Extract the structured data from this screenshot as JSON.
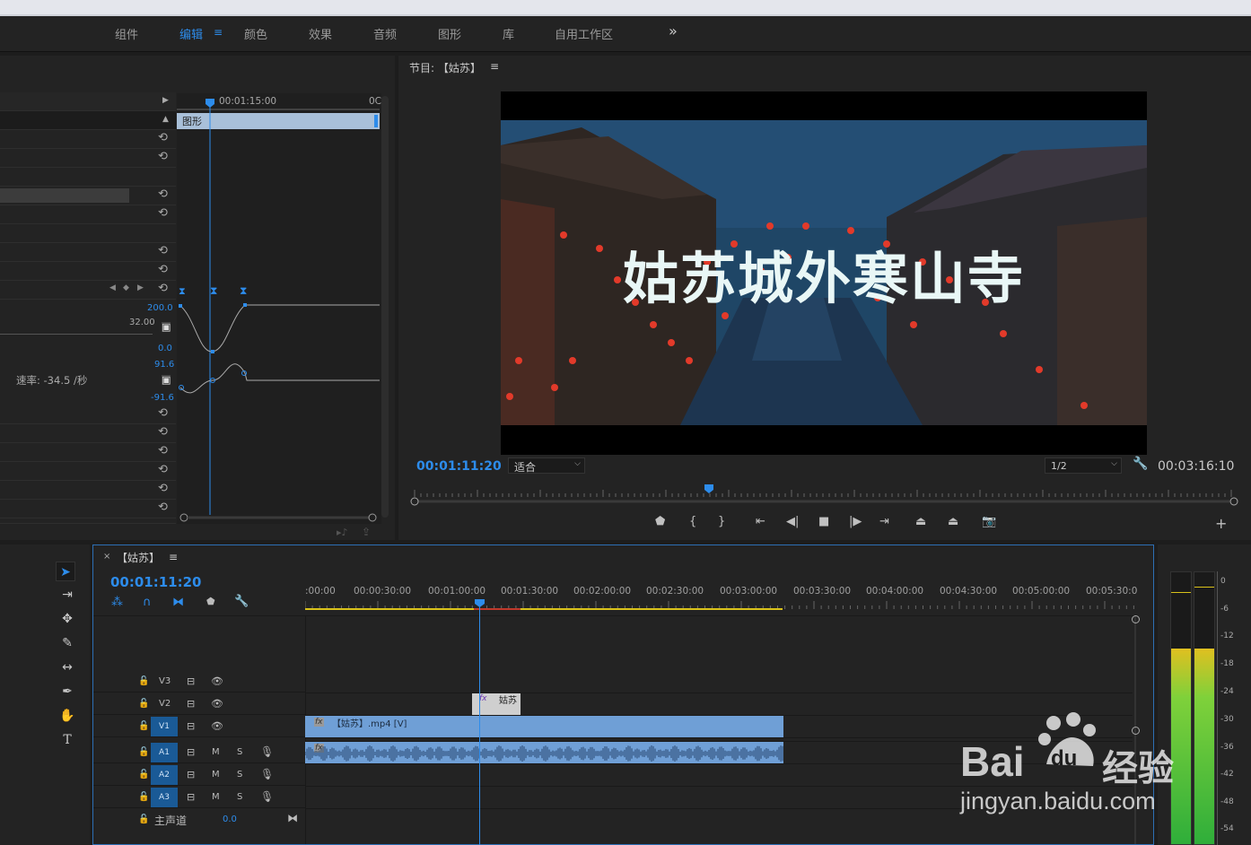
{
  "workspaces": {
    "items": [
      "组件",
      "编辑",
      "颜色",
      "效果",
      "音频",
      "图形",
      "库",
      "自用工作区"
    ],
    "active": "编辑",
    "more": "»"
  },
  "effect_controls": {
    "timecode": "00:01:15:00",
    "timecode_end": "0C",
    "clip_label": "图形",
    "value_200": "200.0",
    "value_32": "32.00",
    "value_0": "0.0",
    "value_916": "91.6",
    "value_neg916": "-91.6",
    "speed_label": "速率: -34.5 /秒"
  },
  "program_monitor": {
    "title": "节目: 【姑苏】",
    "menu_icon": "≡",
    "current_time": "00:01:11:20",
    "fit_label": "适合",
    "resolution": "1/2",
    "duration": "00:03:16:10",
    "video_caption": "姑苏城外寒山寺"
  },
  "timeline": {
    "sequence_name": "【姑苏】",
    "close": "×",
    "menu_icon": "≡",
    "current_time": "00:01:11:20",
    "ruler": [
      ":00:00",
      "00:00:30:00",
      "00:01:00:00",
      "00:01:30:00",
      "00:02:00:00",
      "00:02:30:00",
      "00:03:00:00",
      "00:03:30:00",
      "00:04:00:00",
      "00:04:30:00",
      "00:05:00:00",
      "00:05:30:0"
    ],
    "video_tracks": [
      "V3",
      "V2",
      "V1"
    ],
    "audio_tracks": [
      "A1",
      "A2",
      "A3"
    ],
    "mute_label": "M",
    "solo_label": "S",
    "master_label": "主声道",
    "master_value": "0.0",
    "graphic_clip": "姑苏",
    "video_clip": "【姑苏】.mp4 [V]",
    "fx_label": "fx"
  },
  "meter": {
    "db_labels": [
      "0",
      "-6",
      "-12",
      "-18",
      "-24",
      "-30",
      "-36",
      "-42",
      "-48",
      "-54"
    ],
    "level_left": 0.72,
    "level_right": 0.72
  },
  "watermark": {
    "brand": "Bai",
    "brand_du": "du",
    "brand_cn": "经验",
    "url": "jingyan.baidu.com"
  },
  "colors": {
    "accent": "#2d8ceb",
    "clip_blue": "#6f9fd6",
    "track_toggle": "#1a5a96",
    "yellow_bar": "#d9c21a",
    "meter_green": "#3fbf3f",
    "label_teal": "#2ad3b8"
  }
}
